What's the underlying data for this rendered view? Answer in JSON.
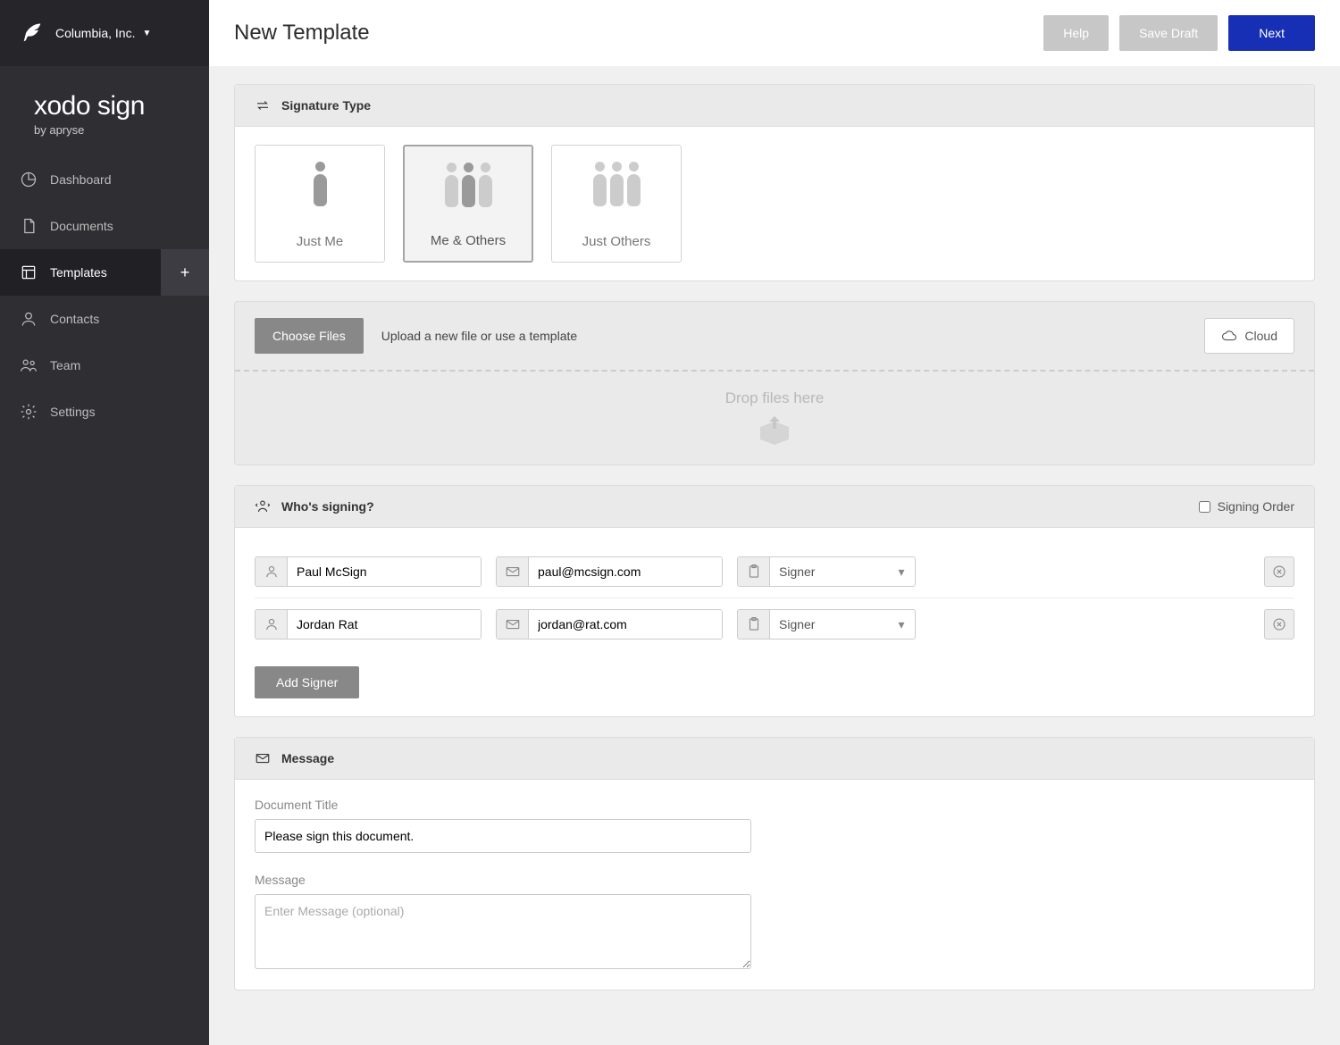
{
  "header": {
    "business": "Columbia, Inc.",
    "brand_name": "xodo sign",
    "brand_sub": "by apryse",
    "page_title": "New Template",
    "help": "Help",
    "save_draft": "Save Draft",
    "next": "Next"
  },
  "nav": {
    "dashboard": "Dashboard",
    "documents": "Documents",
    "templates": "Templates",
    "contacts": "Contacts",
    "team": "Team",
    "settings": "Settings"
  },
  "sigtype": {
    "section_title": "Signature Type",
    "just_me": "Just Me",
    "me_others": "Me & Others",
    "just_others": "Just Others"
  },
  "upload": {
    "choose_files": "Choose Files",
    "hint": "Upload a new file or use a template",
    "cloud": "Cloud",
    "drop": "Drop files here"
  },
  "signers": {
    "section_title": "Who's signing?",
    "signing_order": "Signing Order",
    "add_signer": "Add Signer",
    "rows": [
      {
        "name": "Paul McSign",
        "email": "paul@mcsign.com",
        "role": "Signer"
      },
      {
        "name": "Jordan Rat",
        "email": "jordan@rat.com",
        "role": "Signer"
      }
    ]
  },
  "message": {
    "section_title": "Message",
    "title_label": "Document Title",
    "title_value": "Please sign this document.",
    "message_label": "Message",
    "message_placeholder": "Enter Message (optional)"
  }
}
